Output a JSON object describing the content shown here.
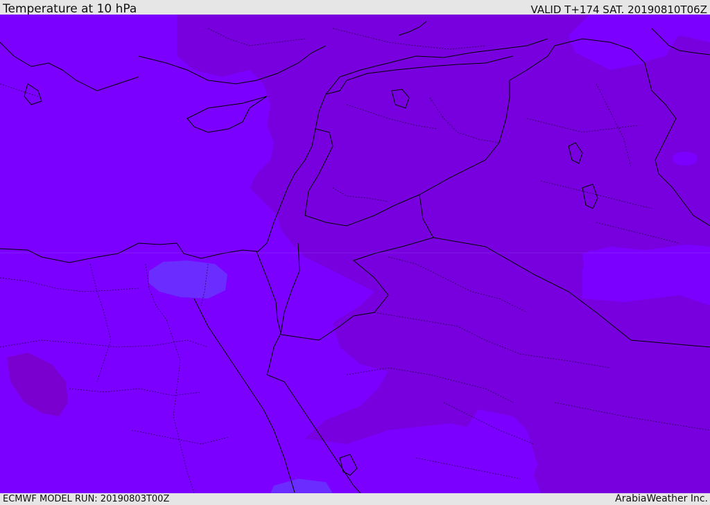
{
  "header": {
    "title": "Temperature at 10 hPa",
    "valid": "VALID T+174 SAT. 20190810T06Z"
  },
  "footer": {
    "model_run": "ECMWF MODEL RUN: 20190803T00Z",
    "credit": "ArabiaWeather Inc."
  },
  "colors": {
    "bar_bg": "#e6e6e6",
    "field_light": "#7b00ff",
    "field_dark": "#7800de",
    "field_blue": "#6a2cff",
    "field_deep": "#7a00d0",
    "border_line": "#000000"
  }
}
